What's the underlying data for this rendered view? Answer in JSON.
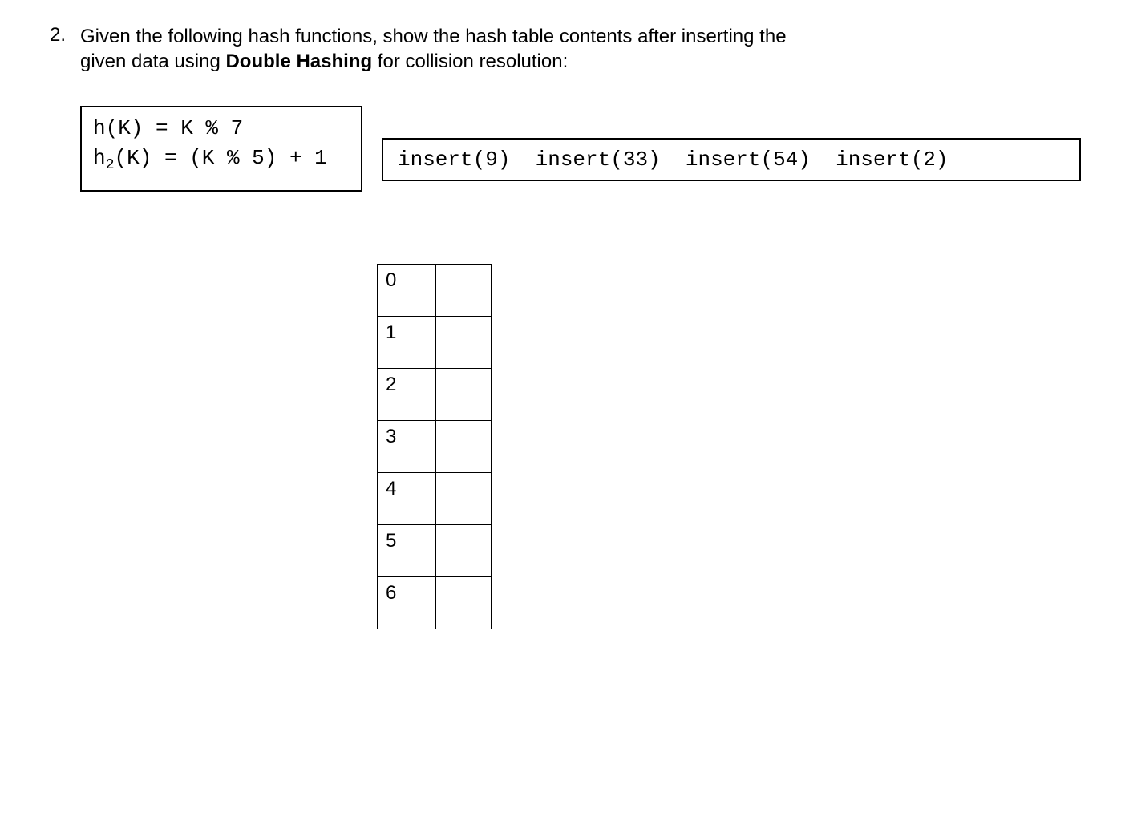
{
  "question": {
    "number": "2.",
    "text_line1": "Given the following hash functions, show the hash table contents after inserting the",
    "text_line2_prefix": "given data using ",
    "text_line2_bold": "Double Hashing",
    "text_line2_suffix": " for collision resolution:"
  },
  "hash_functions": {
    "line1": "h(K) = K % 7",
    "line2_prefix": "h",
    "line2_sub": "2",
    "line2_rest": "(K) = (K % 5) + 1"
  },
  "inserts": "insert(9)  insert(33)  insert(54)  insert(2)",
  "hash_table": {
    "rows": [
      {
        "index": "0",
        "value": ""
      },
      {
        "index": "1",
        "value": ""
      },
      {
        "index": "2",
        "value": ""
      },
      {
        "index": "3",
        "value": ""
      },
      {
        "index": "4",
        "value": ""
      },
      {
        "index": "5",
        "value": ""
      },
      {
        "index": "6",
        "value": ""
      }
    ]
  }
}
